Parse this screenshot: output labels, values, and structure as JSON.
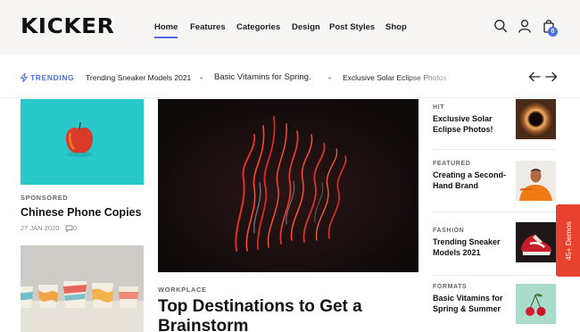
{
  "brand": {
    "logo": "KICKER"
  },
  "nav": {
    "items": [
      {
        "label": "Home",
        "active": true
      },
      {
        "label": "Features",
        "active": false
      },
      {
        "label": "Categories",
        "active": false
      },
      {
        "label": "Design",
        "active": false
      },
      {
        "label": "Post Styles",
        "active": false
      },
      {
        "label": "Shop",
        "active": false
      }
    ],
    "icons": [
      "search-icon",
      "user-icon",
      "shopping-bag-icon"
    ],
    "cart_count": "0",
    "accent": "#4a6fe8"
  },
  "trending": {
    "label": "TRENDING",
    "items": [
      "Trending Sneaker Models 2021",
      "Basic Vitamins for Spring.",
      "Exclusive Solar Eclipse Photos"
    ],
    "prev_icon": "arrow-left-icon",
    "next_icon": "arrow-right-icon"
  },
  "left": {
    "card1": {
      "image": "apple-on-turquoise",
      "category": "SPONSORED",
      "title": "Chinese Phone Copies",
      "date": "27 JAN 2020",
      "comments": "0"
    },
    "card2": {
      "image": "painted-ceramic-cups"
    }
  },
  "center": {
    "image": "red-light-trails",
    "category": "WORKPLACE",
    "title": "Top Destinations to Get a Brainstorm"
  },
  "right": {
    "items": [
      {
        "category": "HIT",
        "title": "Exclusive Solar Eclipse Photos!",
        "image": "solar-eclipse"
      },
      {
        "category": "FEATURED",
        "title": "Creating a Second-Hand Brand",
        "image": "man-in-orange"
      },
      {
        "category": "FASHION",
        "title": "Trending Sneaker Models 2021",
        "image": "red-sneaker"
      },
      {
        "category": "FORMATS",
        "title": "Basic Vitamins for Spring & Summer",
        "image": "cherries"
      }
    ]
  },
  "demos_tab": {
    "label": "45+ Demos",
    "color": "#e8422f"
  }
}
